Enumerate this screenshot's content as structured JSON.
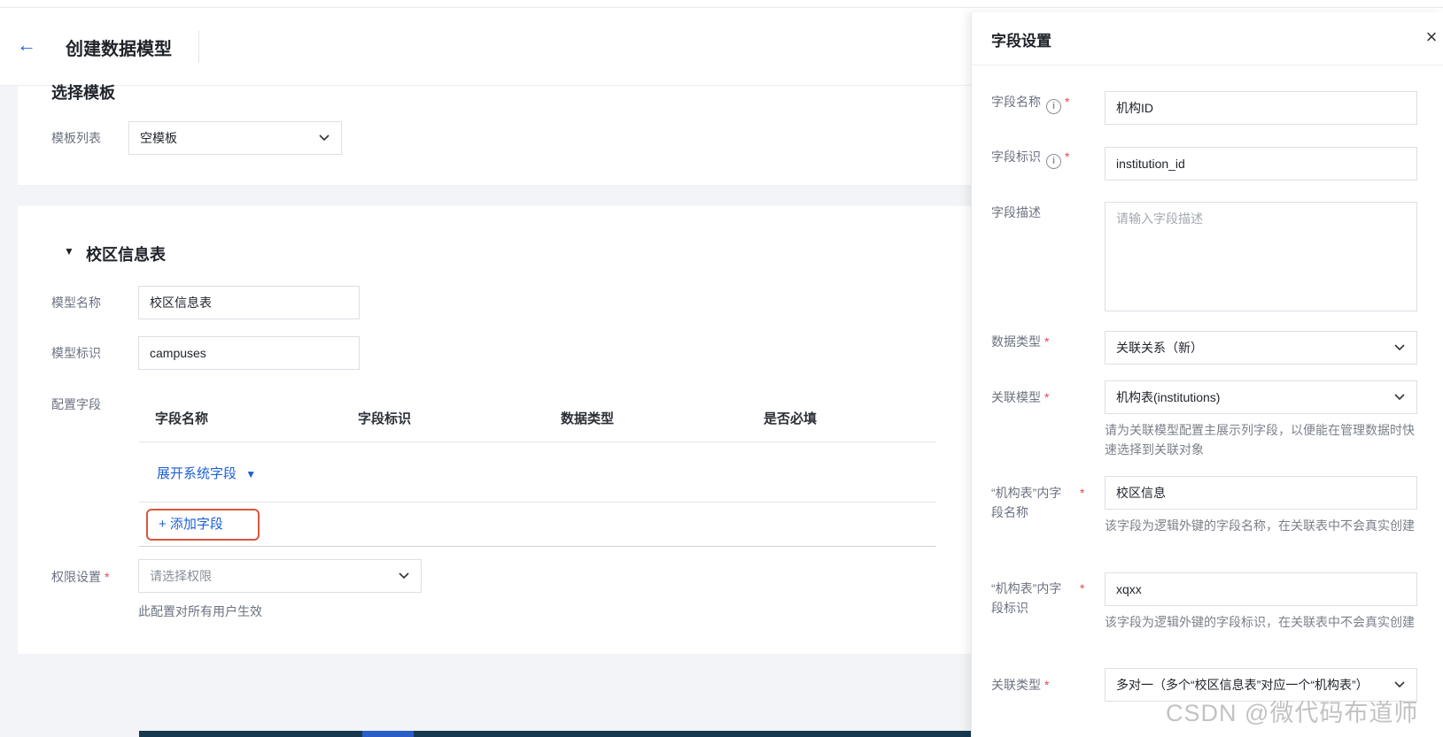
{
  "header": {
    "back_icon": "←",
    "title": "创建数据模型"
  },
  "template_section": {
    "title": "选择模板",
    "list_label": "模板列表",
    "selected": "空模板"
  },
  "model_section": {
    "title": "校区信息表",
    "collapse_icon": "▼",
    "name_label": "模型名称",
    "name_value": "校区信息表",
    "key_label": "模型标识",
    "key_value": "campuses",
    "fields_label": "配置字段",
    "columns": [
      "字段名称",
      "字段标识",
      "数据类型",
      "是否必填"
    ],
    "expand_link": "展开系统字段",
    "expand_icon": "▼",
    "add_button": "+ 添加字段",
    "perm_label": "权限设置",
    "perm_placeholder": "请选择权限",
    "perm_help": "此配置对所有用户生效",
    "required_mark": "*"
  },
  "drawer": {
    "title": "字段设置",
    "close_icon": "×",
    "info_icon": "i",
    "required_mark": "*",
    "field_name_label": "字段名称",
    "field_name_value": "机构ID",
    "field_key_label": "字段标识",
    "field_key_value": "institution_id",
    "desc_label": "字段描述",
    "desc_placeholder": "请输入字段描述",
    "data_type_label": "数据类型",
    "data_type_value": "关联关系（新）",
    "rel_model_label": "关联模型",
    "rel_model_value": "机构表(institutions)",
    "rel_model_help": "请为关联模型配置主展示列字段，以便能在管理数据时快速选择到关联对象",
    "inner_name_label": "“机构表”内字段名称",
    "inner_name_value": "校区信息",
    "inner_name_help": "该字段为逻辑外键的字段名称，在关联表中不会真实创建",
    "inner_key_label": "“机构表”内字段标识",
    "inner_key_value": "xqxx",
    "inner_key_help": "该字段为逻辑外键的字段标识，在关联表中不会真实创建",
    "rel_type_label": "关联类型",
    "rel_type_value": "多对一（多个“校区信息表”对应一个“机构表”）"
  },
  "watermark": "CSDN @微代码布道师"
}
